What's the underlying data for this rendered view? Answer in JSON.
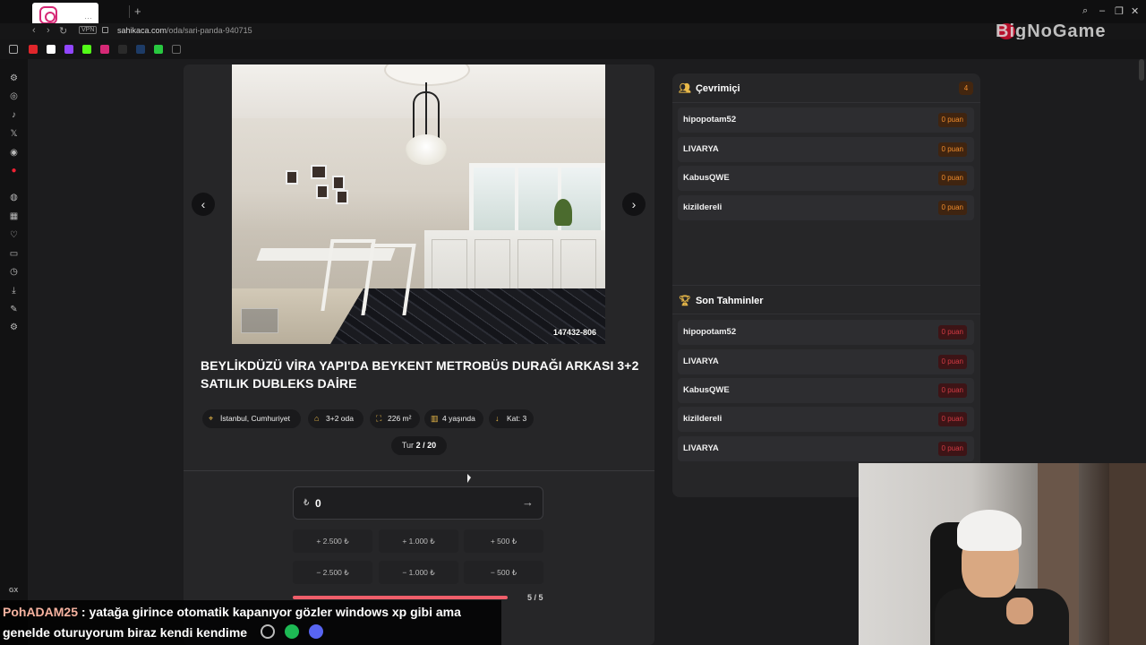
{
  "browser": {
    "url_domain": "sahikaca.com",
    "url_path": "/oda/sari-panda-940715",
    "vpn_label": "VPN",
    "new_tab": "+",
    "brand_overlay": "BigNoGame",
    "sidebar_label": "GX"
  },
  "listing": {
    "photo_id": "147432-806",
    "title": "BEYLİKDÜZÜ VİRA YAPI'DA BEYKENT METROBÜS DURAĞI ARKASI 3+2 SATILIK DUBLEKS DAİRE",
    "chips": [
      {
        "icon": "location-pin-icon",
        "text": "İstanbul, Cumhuriyet"
      },
      {
        "icon": "house-icon",
        "text": "3+2 oda"
      },
      {
        "icon": "area-icon",
        "text": "226 m²"
      },
      {
        "icon": "building-icon",
        "text": "4 yaşında"
      },
      {
        "icon": "floor-arrow-icon",
        "text": "Kat: 3"
      }
    ],
    "round_label": "Tur",
    "round_value": "2 / 20"
  },
  "guess": {
    "currency": "₺",
    "value": "0",
    "plus": [
      "+ 2.500 ₺",
      "+ 1.000 ₺",
      "+ 500 ₺"
    ],
    "minus": [
      "− 2.500 ₺",
      "− 1.000 ₺",
      "− 500 ₺"
    ],
    "progress_fraction": 1.0,
    "progress_text": "5 / 5"
  },
  "online": {
    "title": "Çevrimiçi",
    "count": "4",
    "players": [
      {
        "name": "hipopotam52",
        "score": "0 puan"
      },
      {
        "name": "LIVARYA",
        "score": "0 puan"
      },
      {
        "name": "KabusQWE",
        "score": "0 puan"
      },
      {
        "name": "kizildereli",
        "score": "0 puan"
      }
    ]
  },
  "recent": {
    "title": "Son Tahminler",
    "guesses": [
      {
        "name": "hipopotam52",
        "score": "0 puan"
      },
      {
        "name": "LIVARYA",
        "score": "0 puan"
      },
      {
        "name": "KabusQWE",
        "score": "0 puan"
      },
      {
        "name": "kizildereli",
        "score": "0 puan"
      },
      {
        "name": "LIVARYA",
        "score": "0 puan"
      }
    ]
  },
  "chat": {
    "user": "PohADAM25",
    "line1": " : yatağa girince otomatik kapanıyor gözler windows xp gibi ama",
    "line2": "genelde oturuyorum biraz kendi kendime"
  },
  "colors": {
    "accent_gold": "#e9b949",
    "orange_badge": "#f08c2c",
    "red_badge": "#d23b44",
    "progress": "#ef5e6a"
  }
}
